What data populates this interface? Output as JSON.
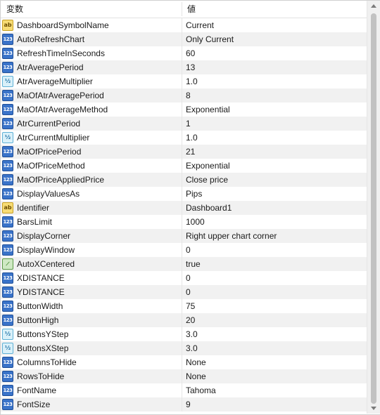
{
  "header": {
    "col_variable": "変数",
    "col_value": "値"
  },
  "params": [
    {
      "type": "string",
      "icon": "string-icon",
      "badge": "ab",
      "name": "DashboardSymbolName",
      "value": "Current"
    },
    {
      "type": "int",
      "icon": "integer-icon",
      "badge": "123",
      "name": "AutoRefreshChart",
      "value": "Only Current"
    },
    {
      "type": "int",
      "icon": "integer-icon",
      "badge": "123",
      "name": "RefreshTimeInSeconds",
      "value": "60"
    },
    {
      "type": "int",
      "icon": "integer-icon",
      "badge": "123",
      "name": "AtrAveragePeriod",
      "value": "13"
    },
    {
      "type": "double",
      "icon": "double-icon",
      "badge": "½",
      "name": "AtrAverageMultiplier",
      "value": "1.0"
    },
    {
      "type": "int",
      "icon": "integer-icon",
      "badge": "123",
      "name": "MaOfAtrAveragePeriod",
      "value": "8"
    },
    {
      "type": "int",
      "icon": "integer-icon",
      "badge": "123",
      "name": "MaOfAtrAverageMethod",
      "value": "Exponential"
    },
    {
      "type": "int",
      "icon": "integer-icon",
      "badge": "123",
      "name": "AtrCurrentPeriod",
      "value": "1"
    },
    {
      "type": "double",
      "icon": "double-icon",
      "badge": "½",
      "name": "AtrCurrentMultiplier",
      "value": "1.0"
    },
    {
      "type": "int",
      "icon": "integer-icon",
      "badge": "123",
      "name": "MaOfPricePeriod",
      "value": "21"
    },
    {
      "type": "int",
      "icon": "integer-icon",
      "badge": "123",
      "name": "MaOfPriceMethod",
      "value": "Exponential"
    },
    {
      "type": "int",
      "icon": "integer-icon",
      "badge": "123",
      "name": "MaOfPriceAppliedPrice",
      "value": "Close price"
    },
    {
      "type": "int",
      "icon": "integer-icon",
      "badge": "123",
      "name": "DisplayValuesAs",
      "value": "Pips"
    },
    {
      "type": "string",
      "icon": "string-icon",
      "badge": "ab",
      "name": "Identifier",
      "value": "Dashboard1"
    },
    {
      "type": "int",
      "icon": "integer-icon",
      "badge": "123",
      "name": "BarsLimit",
      "value": "1000"
    },
    {
      "type": "int",
      "icon": "integer-icon",
      "badge": "123",
      "name": "DisplayCorner",
      "value": "Right upper chart corner"
    },
    {
      "type": "int",
      "icon": "integer-icon",
      "badge": "123",
      "name": "DisplayWindow",
      "value": "0"
    },
    {
      "type": "bool",
      "icon": "boolean-icon",
      "badge": "⟋",
      "name": "AutoXCentered",
      "value": "true"
    },
    {
      "type": "int",
      "icon": "integer-icon",
      "badge": "123",
      "name": "XDISTANCE",
      "value": "0"
    },
    {
      "type": "int",
      "icon": "integer-icon",
      "badge": "123",
      "name": "YDISTANCE",
      "value": "0"
    },
    {
      "type": "int",
      "icon": "integer-icon",
      "badge": "123",
      "name": "ButtonWidth",
      "value": "75"
    },
    {
      "type": "int",
      "icon": "integer-icon",
      "badge": "123",
      "name": "ButtonHigh",
      "value": "20"
    },
    {
      "type": "double",
      "icon": "double-icon",
      "badge": "½",
      "name": "ButtonsYStep",
      "value": "3.0"
    },
    {
      "type": "double",
      "icon": "double-icon",
      "badge": "½",
      "name": "ButtonsXStep",
      "value": "3.0"
    },
    {
      "type": "int",
      "icon": "integer-icon",
      "badge": "123",
      "name": "ColumnsToHide",
      "value": "None"
    },
    {
      "type": "int",
      "icon": "integer-icon",
      "badge": "123",
      "name": "RowsToHide",
      "value": "None"
    },
    {
      "type": "int",
      "icon": "integer-icon",
      "badge": "123",
      "name": "FontName",
      "value": "Tahoma"
    },
    {
      "type": "int",
      "icon": "integer-icon",
      "badge": "123",
      "name": "FontSize",
      "value": "9"
    }
  ]
}
